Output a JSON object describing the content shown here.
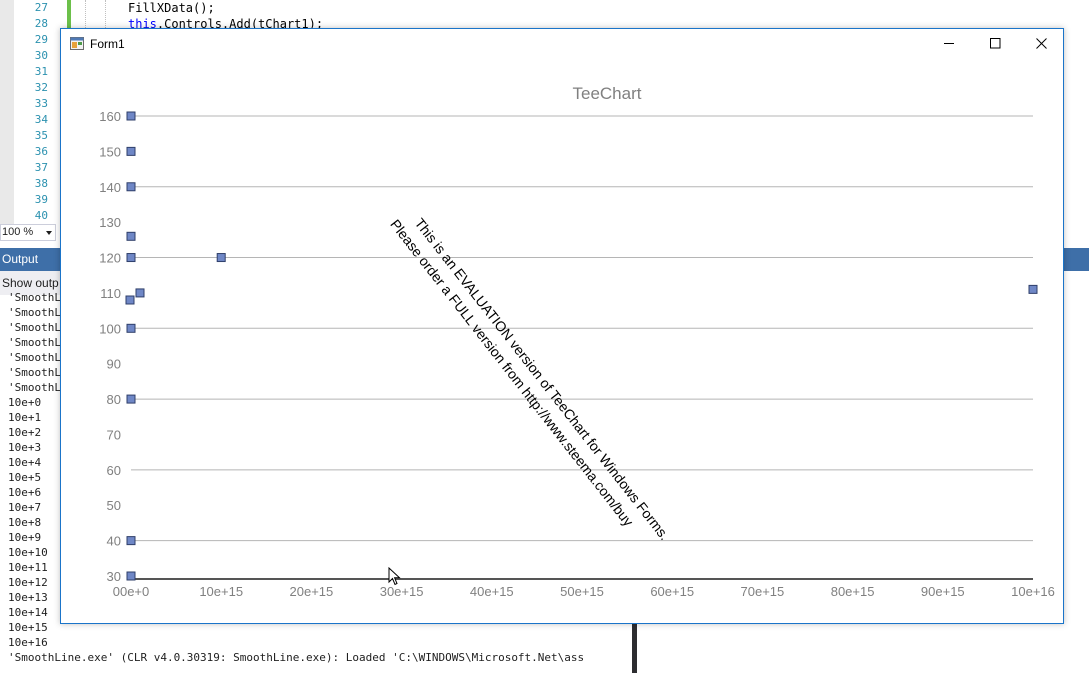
{
  "editor": {
    "line_numbers": [
      "27",
      "28",
      "29",
      "30",
      "31",
      "32",
      "33",
      "34",
      "35",
      "36",
      "37",
      "38",
      "39",
      "40"
    ],
    "code_lines": [
      {
        "plain": "FillXData();"
      },
      {
        "keyword": "this",
        "rest": ".Controls.Add(tChart1);"
      }
    ],
    "zoom": "100 %"
  },
  "output_panel": {
    "title": "Output",
    "show_output_label": "Show outp",
    "lines": [
      "'SmoothL",
      "'SmoothL",
      "'SmoothL",
      "'SmoothL",
      "'SmoothL",
      "'SmoothL",
      "'SmoothL",
      "10e+0",
      "10e+1",
      "10e+2",
      "10e+3",
      "10e+4",
      "10e+5",
      "10e+6",
      "10e+7",
      "10e+8",
      "10e+9",
      "10e+10",
      "10e+11",
      "10e+12",
      "10e+13",
      "10e+14",
      "10e+15",
      "10e+16",
      "'SmoothLine.exe' (CLR v4.0.30319: SmoothLine.exe): Loaded 'C:\\WINDOWS\\Microsoft.Net\\ass"
    ]
  },
  "form": {
    "title": "Form1",
    "icon": "winforms-app-icon",
    "buttons": [
      "minimize-icon",
      "maximize-icon",
      "close-icon"
    ]
  },
  "chart_data": {
    "type": "scatter",
    "title": "TeeChart",
    "xlabel": "",
    "ylabel": "",
    "xlim": [
      0,
      1e+16
    ],
    "ylim": [
      30,
      160
    ],
    "x_ticks": [
      "00e+0",
      "10e+15",
      "20e+15",
      "30e+15",
      "40e+15",
      "50e+15",
      "60e+15",
      "70e+15",
      "80e+15",
      "90e+15",
      "10e+16"
    ],
    "x_tick_values": [
      0,
      1000000000000000.0,
      2000000000000000.0,
      3000000000000000.0,
      4000000000000000.0,
      5000000000000000.0,
      6000000000000000.0,
      7000000000000000.0,
      8000000000000000.0,
      9000000000000000.0,
      1e+16
    ],
    "y_ticks": [
      160,
      150,
      140,
      130,
      120,
      110,
      100,
      90,
      80,
      70,
      60,
      50,
      40,
      30
    ],
    "y_gridlines": [
      160,
      140,
      120,
      100,
      80,
      60,
      40
    ],
    "grid": true,
    "series": [
      {
        "marker": "square",
        "color": "#6f87c6",
        "points": [
          [
            0,
            160
          ],
          [
            0,
            150
          ],
          [
            0,
            140
          ],
          [
            0,
            126
          ],
          [
            0,
            120
          ],
          [
            1.0,
            110
          ],
          [
            0,
            108
          ],
          [
            0,
            100
          ],
          [
            0,
            80
          ],
          [
            0,
            40
          ],
          [
            0,
            30
          ],
          [
            1000000000000000.0,
            120
          ],
          [
            1e+16,
            111
          ]
        ]
      }
    ],
    "watermark": [
      "This is an EVALUATION version of TeeChart for Windows Forms.",
      "Please order a FULL version from http://www.steema.com/buy"
    ]
  }
}
